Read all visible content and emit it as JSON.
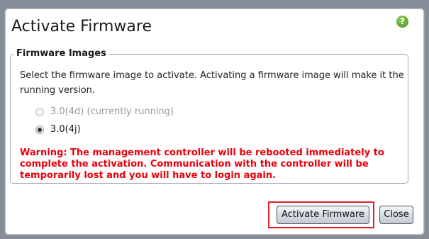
{
  "dialog": {
    "title": "Activate Firmware",
    "help_icon": "help-icon"
  },
  "fieldset": {
    "legend": "Firmware Images",
    "description": "Select the firmware image to activate. Activating a firmware image will make it the running version.",
    "options": [
      {
        "label": "3.0(4d) (currently running)",
        "selected": false,
        "disabled": true
      },
      {
        "label": "3.0(4j)",
        "selected": true,
        "disabled": false
      }
    ],
    "warning": "Warning: The management controller will be rebooted immediately to complete the activation. Communication with the controller will be temporarily lost and you will have to login again."
  },
  "buttons": {
    "activate_label": "Activate Firmware",
    "close_label": "Close"
  },
  "colors": {
    "warning": "#e8000b",
    "focus_ring": "#e0202a",
    "help_icon": "#3f8f1d"
  }
}
